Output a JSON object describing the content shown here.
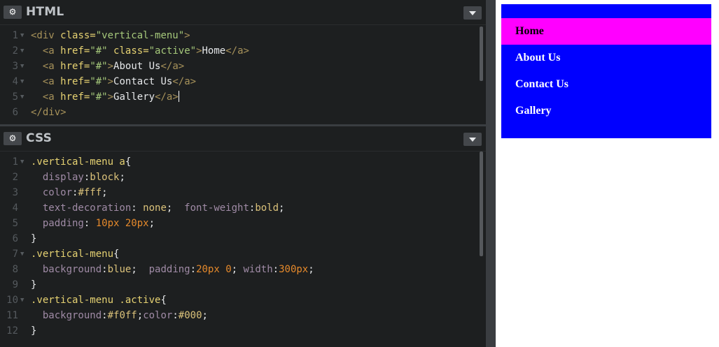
{
  "html_panel": {
    "title": "HTML",
    "gear_icon": "⚙",
    "lines": [
      {
        "n": "1",
        "fold": "▼",
        "tokens": [
          [
            "tag",
            "<div "
          ],
          [
            "attr",
            "class="
          ],
          [
            "str",
            "\"vertical-menu\""
          ],
          [
            "tag",
            ">"
          ]
        ]
      },
      {
        "n": "2",
        "fold": "▼",
        "tokens": [
          [
            "plain",
            "  "
          ],
          [
            "tag",
            "<a "
          ],
          [
            "attr",
            "href="
          ],
          [
            "str",
            "\"#\""
          ],
          [
            "plain",
            " "
          ],
          [
            "attr",
            "class="
          ],
          [
            "str",
            "\"active\""
          ],
          [
            "tag",
            ">"
          ],
          [
            "plain",
            "Home"
          ],
          [
            "tag",
            "</a>"
          ]
        ]
      },
      {
        "n": "3",
        "fold": "▼",
        "tokens": [
          [
            "plain",
            "  "
          ],
          [
            "tag",
            "<a "
          ],
          [
            "attr",
            "href="
          ],
          [
            "str",
            "\"#\""
          ],
          [
            "tag",
            ">"
          ],
          [
            "plain",
            "About Us"
          ],
          [
            "tag",
            "</a>"
          ]
        ]
      },
      {
        "n": "4",
        "fold": "▼",
        "tokens": [
          [
            "plain",
            "  "
          ],
          [
            "tag",
            "<a "
          ],
          [
            "attr",
            "href="
          ],
          [
            "str",
            "\"#\""
          ],
          [
            "tag",
            ">"
          ],
          [
            "plain",
            "Contact Us"
          ],
          [
            "tag",
            "</a>"
          ]
        ]
      },
      {
        "n": "5",
        "fold": "▼",
        "tokens": [
          [
            "plain",
            "  "
          ],
          [
            "tag",
            "<a "
          ],
          [
            "attr",
            "href="
          ],
          [
            "str",
            "\"#\""
          ],
          [
            "tag",
            ">"
          ],
          [
            "plain",
            "Gallery"
          ],
          [
            "tag",
            "</a>"
          ]
        ]
      },
      {
        "n": "6",
        "fold": "",
        "tokens": [
          [
            "tag",
            "</div>"
          ]
        ]
      }
    ]
  },
  "css_panel": {
    "title": "CSS",
    "gear_icon": "⚙",
    "lines": [
      {
        "n": "1",
        "fold": "▼",
        "tokens": [
          [
            "sel",
            ".vertical-menu a"
          ],
          [
            "punct",
            "{"
          ]
        ]
      },
      {
        "n": "2",
        "fold": "",
        "tokens": [
          [
            "plain",
            "  "
          ],
          [
            "prop",
            "display"
          ],
          [
            "punct",
            ":"
          ],
          [
            "kw",
            "block"
          ],
          [
            "punct",
            ";"
          ]
        ]
      },
      {
        "n": "3",
        "fold": "",
        "tokens": [
          [
            "plain",
            "  "
          ],
          [
            "prop",
            "color"
          ],
          [
            "punct",
            ":"
          ],
          [
            "kw",
            "#fff"
          ],
          [
            "punct",
            ";"
          ]
        ]
      },
      {
        "n": "4",
        "fold": "",
        "tokens": [
          [
            "plain",
            "  "
          ],
          [
            "prop",
            "text-decoration"
          ],
          [
            "punct",
            ": "
          ],
          [
            "kw",
            "none"
          ],
          [
            "punct",
            ";  "
          ],
          [
            "prop",
            "font-weight"
          ],
          [
            "punct",
            ":"
          ],
          [
            "kw",
            "bold"
          ],
          [
            "punct",
            ";"
          ]
        ]
      },
      {
        "n": "5",
        "fold": "",
        "tokens": [
          [
            "plain",
            "  "
          ],
          [
            "prop",
            "padding"
          ],
          [
            "punct",
            ": "
          ],
          [
            "num",
            "10px 20px"
          ],
          [
            "punct",
            ";"
          ]
        ]
      },
      {
        "n": "6",
        "fold": "",
        "tokens": [
          [
            "punct",
            "}"
          ]
        ]
      },
      {
        "n": "7",
        "fold": "▼",
        "tokens": [
          [
            "sel",
            ".vertical-menu"
          ],
          [
            "punct",
            "{"
          ]
        ]
      },
      {
        "n": "8",
        "fold": "",
        "tokens": [
          [
            "plain",
            "  "
          ],
          [
            "prop",
            "background"
          ],
          [
            "punct",
            ":"
          ],
          [
            "kw",
            "blue"
          ],
          [
            "punct",
            ";  "
          ],
          [
            "prop",
            "padding"
          ],
          [
            "punct",
            ":"
          ],
          [
            "num",
            "20px 0"
          ],
          [
            "punct",
            "; "
          ],
          [
            "prop",
            "width"
          ],
          [
            "punct",
            ":"
          ],
          [
            "num",
            "300px"
          ],
          [
            "punct",
            ";"
          ]
        ]
      },
      {
        "n": "9",
        "fold": "",
        "tokens": [
          [
            "punct",
            "}"
          ]
        ]
      },
      {
        "n": "10",
        "fold": "▼",
        "tokens": [
          [
            "sel",
            ".vertical-menu .active"
          ],
          [
            "punct",
            "{"
          ]
        ]
      },
      {
        "n": "11",
        "fold": "",
        "tokens": [
          [
            "plain",
            "  "
          ],
          [
            "prop",
            "background"
          ],
          [
            "punct",
            ":"
          ],
          [
            "kw",
            "#f0ff"
          ],
          [
            "punct",
            ";"
          ],
          [
            "prop",
            "color"
          ],
          [
            "punct",
            ":"
          ],
          [
            "kw",
            "#000"
          ],
          [
            "punct",
            ";"
          ]
        ]
      },
      {
        "n": "12",
        "fold": "",
        "tokens": [
          [
            "punct",
            "}"
          ]
        ]
      }
    ]
  },
  "preview": {
    "menu_items": [
      {
        "label": "Home",
        "active": true
      },
      {
        "label": "About Us",
        "active": false
      },
      {
        "label": "Contact Us",
        "active": false
      },
      {
        "label": "Gallery",
        "active": false
      }
    ]
  },
  "colors": {
    "editor_bg": "#1d1f20",
    "menu_bg": "#0000ff",
    "active_bg": "#ff00ff"
  }
}
